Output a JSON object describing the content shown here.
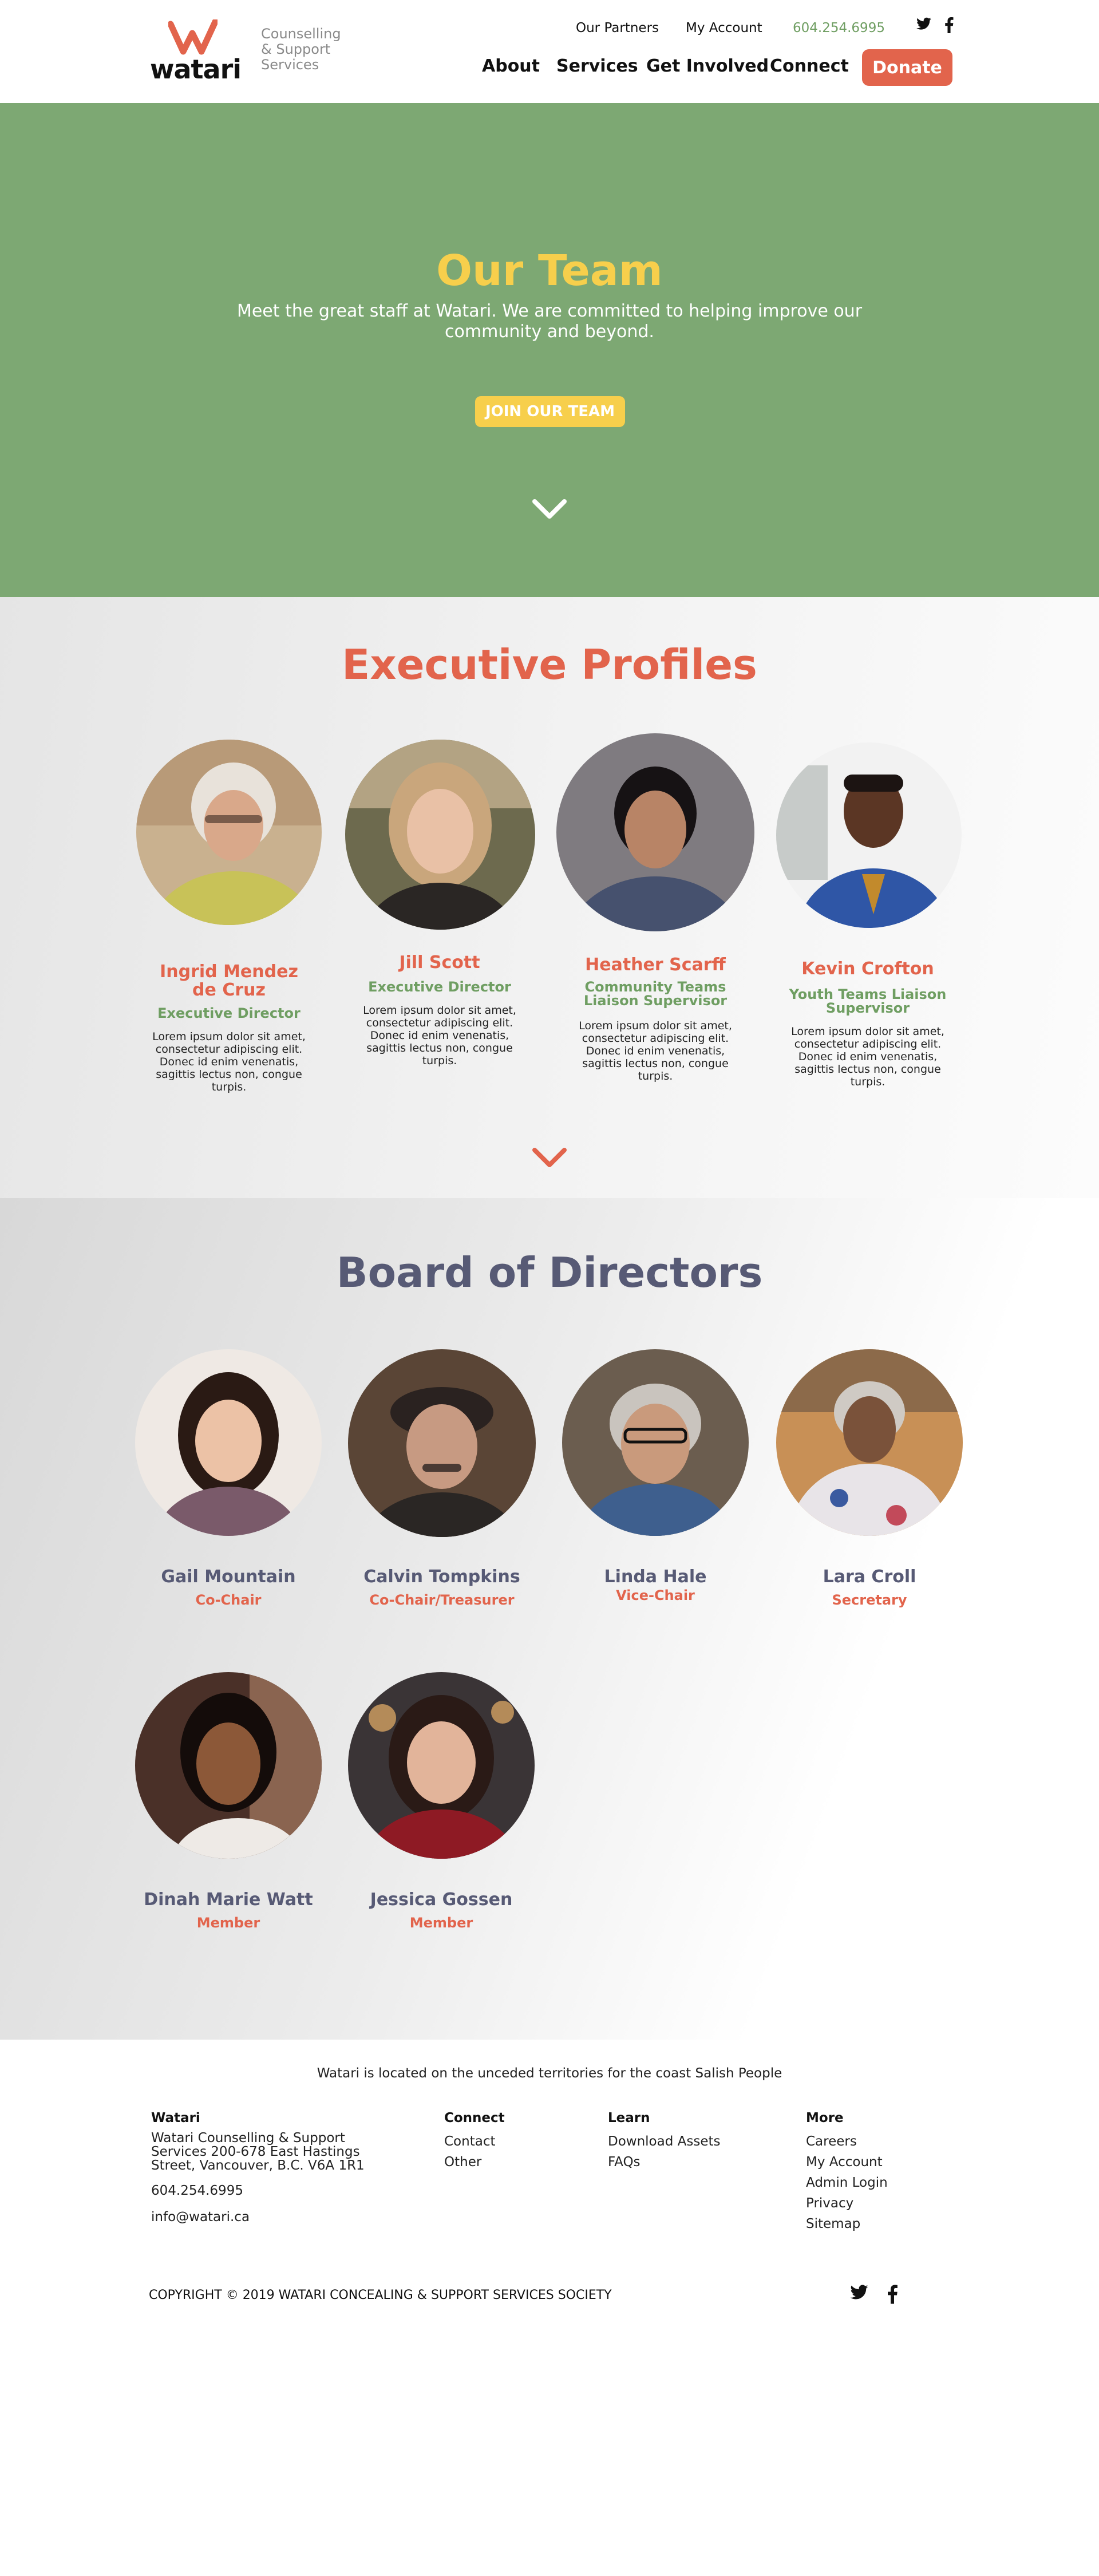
{
  "header": {
    "logo_text": "watari",
    "tagline": [
      "Counselling",
      "& Support",
      "Services"
    ],
    "util_links": [
      "Our Partners",
      "My Account"
    ],
    "phone": "604.254.6995",
    "nav": [
      "About",
      "Services",
      "Get Involved",
      "Connect"
    ],
    "donate": "Donate"
  },
  "hero": {
    "title": "Our Team",
    "subtitle_line1": "Meet the great staff at Watari. We are committed to helping improve our",
    "subtitle_line2": "community and beyond.",
    "cta": "JOIN OUR TEAM"
  },
  "executive": {
    "title": "Executive Profiles",
    "people": [
      {
        "name": [
          "Ingrid Mendez",
          "de Cruz"
        ],
        "role": [
          "Executive Director"
        ],
        "bio": [
          "Lorem ipsum dolor sit amet,",
          "consectetur adipiscing elit.",
          "Donec id enim venenatis,",
          "sagittis lectus non, congue",
          "turpis."
        ]
      },
      {
        "name": [
          "Jill Scott"
        ],
        "role": [
          "Executive Director"
        ],
        "bio": [
          "Lorem ipsum dolor sit amet,",
          "consectetur adipiscing elit.",
          "Donec id enim venenatis,",
          "sagittis lectus non, congue",
          "turpis."
        ]
      },
      {
        "name": [
          "Heather Scarff"
        ],
        "role": [
          "Community Teams",
          "Liaison Supervisor"
        ],
        "bio": [
          "Lorem ipsum dolor sit amet,",
          "consectetur adipiscing elit.",
          "Donec id enim venenatis,",
          "sagittis lectus non, congue",
          "turpis."
        ]
      },
      {
        "name": [
          "Kevin Crofton"
        ],
        "role": [
          "Youth Teams Liaison",
          "Supervisor"
        ],
        "bio": [
          "Lorem ipsum dolor sit amet,",
          "consectetur adipiscing elit.",
          "Donec id enim venenatis,",
          "sagittis lectus non, congue",
          "turpis."
        ]
      }
    ]
  },
  "board": {
    "title": "Board of Directors",
    "people": [
      {
        "name": "Gail Mountain",
        "role": "Co-Chair"
      },
      {
        "name": "Calvin Tompkins",
        "role": "Co-Chair/Treasurer"
      },
      {
        "name": "Linda Hale",
        "role": "Vice-Chair"
      },
      {
        "name": "Lara Croll",
        "role": "Secretary"
      },
      {
        "name": "Dinah Marie Watt",
        "role": "Member"
      },
      {
        "name": "Jessica Gossen",
        "role": "Member"
      }
    ]
  },
  "footer": {
    "land": "Watari is located on the unceded territories for the coast Salish People",
    "col1": {
      "head": "Watari",
      "address": [
        "Watari Counselling & Support",
        "Services 200-678 East Hastings",
        "Street, Vancouver, B.C. V6A 1R1"
      ],
      "phone": "604.254.6995",
      "email": "info@watari.ca"
    },
    "col2": {
      "head": "Connect",
      "links": [
        "Contact",
        "Other"
      ]
    },
    "col3": {
      "head": "Learn",
      "links": [
        "Download Assets",
        "FAQs"
      ]
    },
    "col4": {
      "head": "More",
      "links": [
        "Careers",
        "My Account",
        "Admin Login",
        "Privacy",
        "Sitemap"
      ]
    },
    "copyright": "COPYRIGHT © 2019 WATARI CONCEALING & SUPPORT SERVICES SOCIETY"
  },
  "colors": {
    "brand_red": "#e2644c",
    "green": "#7da873",
    "yellow": "#f7cf4c",
    "slate": "#575a75"
  },
  "icons": [
    "twitter-icon",
    "facebook-icon",
    "chevron-down-icon",
    "watari-logo-mark"
  ]
}
